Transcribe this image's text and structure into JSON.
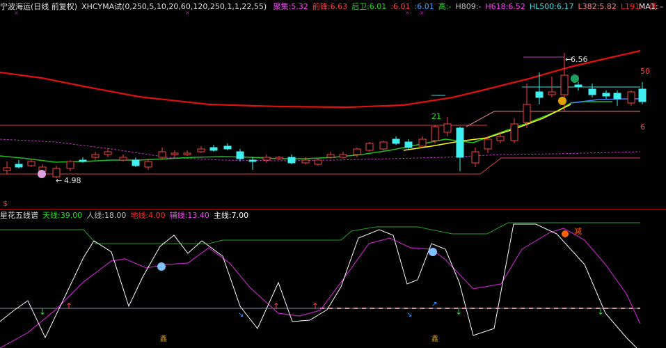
{
  "header": {
    "stock_title": "宁波海运(日线 前复权)",
    "indicator_formula": "XHCYMA试(0,250,5,10,20,60,120,250,1,1,22,55)",
    "fields": [
      {
        "label": "聚集:",
        "value": "5.32",
        "color": "#ff40ff"
      },
      {
        "label": "前锋:",
        "value": "6.63",
        "color": "#ff4040"
      },
      {
        "label": "后卫:",
        "value": "6.01",
        "color": "#20e020"
      },
      {
        "label": ":",
        "value": "6.01",
        "color": "#ff4040"
      },
      {
        "label": ":",
        "value": "6.01",
        "color": "#40a0ff"
      },
      {
        "label": "高:",
        "value": "-",
        "color": "#20e020"
      },
      {
        "label": "H809:",
        "value": "-",
        "color": "#c0c0c0"
      },
      {
        "label": "H618:",
        "value": "6.52",
        "color": "#ff40ff"
      },
      {
        "label": "HL500:",
        "value": "6.17",
        "color": "#40e0e0"
      },
      {
        "label": "L382:",
        "value": "5.82",
        "color": "#ff8080"
      },
      {
        "label": "L191:",
        "value": "-",
        "color": "#ff2020"
      },
      {
        "label": "低:",
        "value": "-",
        "color": "#ff2020"
      }
    ],
    "ma_label": "MA1: -"
  },
  "price_chart": {
    "high_annotation": "6.56",
    "low_annotation": "4.98",
    "count_label": "21",
    "right_label_top": "50",
    "right_label_bottom": "6",
    "bottom_marker": "$"
  },
  "indicator": {
    "name": "星花五线谱",
    "fields": [
      {
        "label": "天线:",
        "value": "39.00",
        "color": "#20e020"
      },
      {
        "label": "人线:",
        "value": "18.00",
        "color": "#c0c0c0"
      },
      {
        "label": "地线:",
        "value": "4.00",
        "color": "#ff3030"
      },
      {
        "label": "辅线:",
        "value": "13.40",
        "color": "#ff40ff"
      },
      {
        "label": "主线:",
        "value": "7.00",
        "color": "#ffffff"
      }
    ],
    "signal_reduce": "减",
    "gold_markers": [
      "鑫",
      "鑫"
    ]
  },
  "colors": {
    "up": "#ff4040",
    "down": "#40f0f0",
    "ma_red": "#e01010",
    "ma_yellow": "#ffff00",
    "ma_green": "#20c020"
  }
}
